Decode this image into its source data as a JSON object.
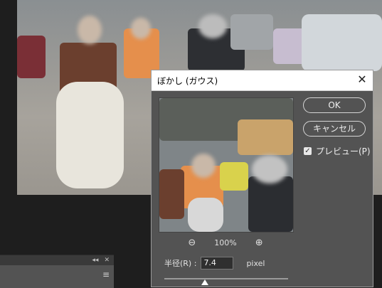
{
  "dialog": {
    "title": "ぼかし (ガウス)",
    "ok_label": "OK",
    "cancel_label": "キャンセル",
    "preview_label": "プレビュー(P)",
    "preview_checked": true,
    "zoom_level": "100%",
    "radius_label": "半径(R) :",
    "radius_value": "7.4",
    "radius_unit": "pixel"
  },
  "panel": {
    "collapse_glyph": "◂◂",
    "close_glyph": "✕",
    "menu_glyph": "≡"
  },
  "icons": {
    "close": "close-icon",
    "zoom_out": "zoom-out-icon",
    "zoom_in": "zoom-in-icon",
    "check": "checkmark-icon",
    "menu": "panel-menu-icon"
  },
  "colors": {
    "dialog_bg": "#535353",
    "titlebar_bg": "#ffffff",
    "app_bg": "#1e1e1e"
  }
}
